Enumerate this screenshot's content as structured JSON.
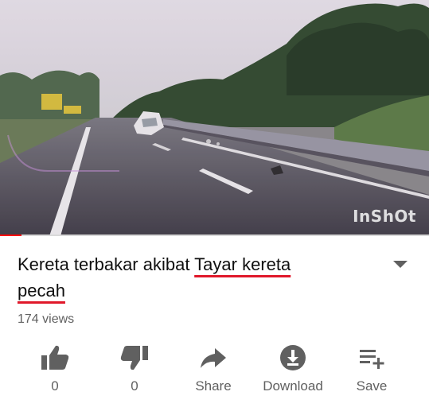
{
  "video": {
    "watermark": "InShOt",
    "progress_fraction": 0.05
  },
  "title": {
    "part1": "Kereta terbakar akibat ",
    "part2": "Tayar kereta",
    "part3": "pecah",
    "underline_color": "#e0182a"
  },
  "views": "174 views",
  "actions": {
    "like": {
      "label": "0",
      "icon": "thumbs-up-icon"
    },
    "dislike": {
      "label": "0",
      "icon": "thumbs-down-icon"
    },
    "share": {
      "label": "Share",
      "icon": "share-arrow-icon"
    },
    "download": {
      "label": "Download",
      "icon": "download-icon"
    },
    "save": {
      "label": "Save",
      "icon": "playlist-add-icon"
    }
  },
  "colors": {
    "progress": "#ff0000",
    "icon": "#606060",
    "text": "#0f0f0f"
  }
}
